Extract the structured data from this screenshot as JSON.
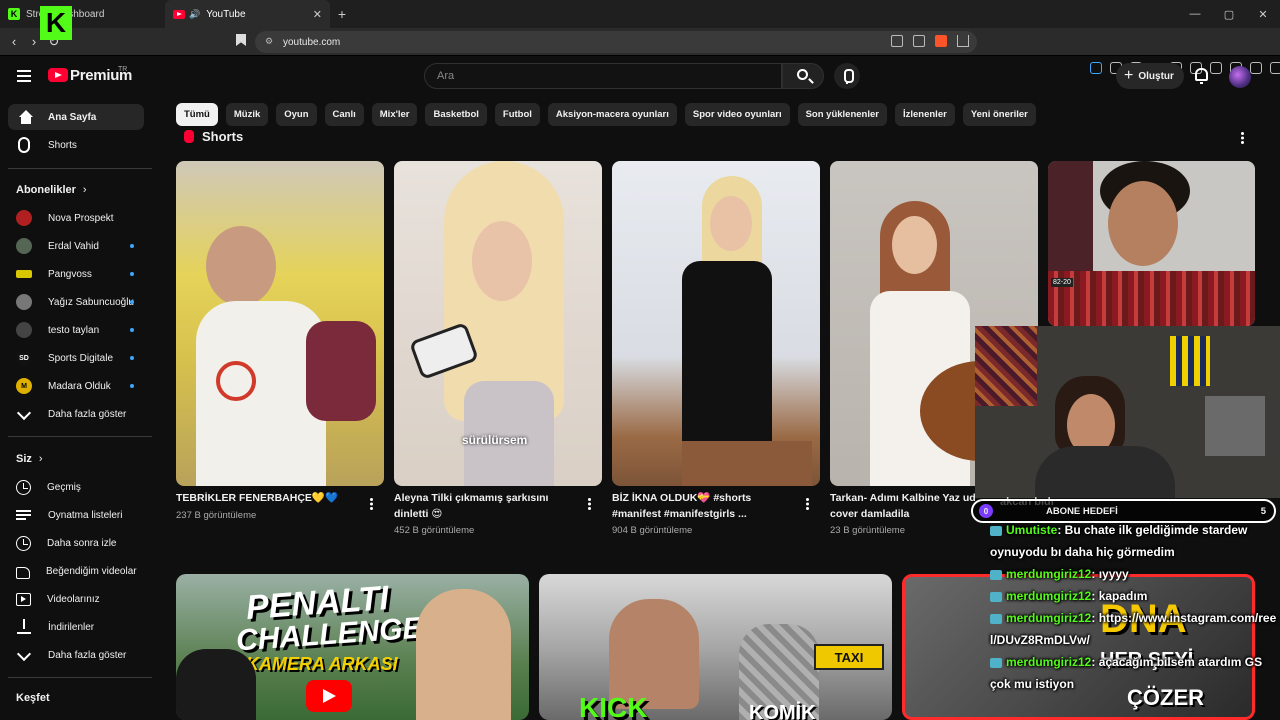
{
  "browser": {
    "tabs": [
      {
        "title": "Stre... Dashboard",
        "favicon": "kick-favicon"
      },
      {
        "title": "YouTube",
        "favicon": "youtube-favicon"
      }
    ],
    "url": "youtube.com",
    "kick_logo": "K"
  },
  "header": {
    "logo_text": "Premium",
    "logo_sup": "TR",
    "search_placeholder": "Ara",
    "create_label": "Oluştur"
  },
  "sidebar": {
    "main": [
      {
        "label": "Ana Sayfa",
        "icon": "home-icon",
        "active": true
      },
      {
        "label": "Shorts",
        "icon": "shorts-icon"
      }
    ],
    "subscriptions_title": "Abonelikler",
    "subscriptions": [
      {
        "label": "Nova Prospekt",
        "dot": false,
        "color": "#b02020"
      },
      {
        "label": "Erdal Vahid",
        "dot": true,
        "color": "#556655"
      },
      {
        "label": "Pangvoss",
        "dot": true,
        "color": "#d8c800"
      },
      {
        "label": "Yağız Sabuncuoğlu",
        "dot": true,
        "color": "#777777"
      },
      {
        "label": "testo taylan",
        "dot": true,
        "color": "#444444"
      },
      {
        "label": "Sports Digitale",
        "dot": true,
        "color": "#111111"
      },
      {
        "label": "Madara Olduk",
        "dot": true,
        "color": "#e0b000"
      }
    ],
    "show_more": "Daha fazla göster",
    "you_title": "Siz",
    "you_items": [
      {
        "label": "Geçmiş",
        "icon": "history-icon"
      },
      {
        "label": "Oynatma listeleri",
        "icon": "playlists-icon"
      },
      {
        "label": "Daha sonra izle",
        "icon": "watch-later-icon"
      },
      {
        "label": "Beğendiğim videolar",
        "icon": "liked-videos-icon"
      },
      {
        "label": "Videolarınız",
        "icon": "your-videos-icon"
      },
      {
        "label": "İndirilenler",
        "icon": "downloads-icon"
      },
      {
        "label": "Daha fazla göster",
        "icon": "chevron-down-icon"
      }
    ],
    "explore_title": "Keşfet"
  },
  "chips": [
    "Tümü",
    "Müzik",
    "Oyun",
    "Canlı",
    "Mix'ler",
    "Basketbol",
    "Futbol",
    "Aksiyon-macera oyunları",
    "Spor video oyunları",
    "Son yüklenenler",
    "İzlenenler",
    "Yeni öneriler"
  ],
  "shorts_title": "Shorts",
  "shorts": [
    {
      "title": "TEBRİKLER FENERBAHÇE💛💙",
      "views": "237 B görüntüleme"
    },
    {
      "title": "Aleyna Tilki çıkmamış şarkısını dinletti 😍",
      "views": "452 B görüntüleme",
      "overlay": "sürülürsem"
    },
    {
      "title": "BİZ İKNA OLDUK💝 #shorts #manifest #manifestgirls ...",
      "views": "904 B görüntüleme"
    },
    {
      "title": "Tarkan- Adımı Kalbine Yaz ud cover damladila",
      "views": "23 B görüntüleme"
    }
  ],
  "videos": [
    {
      "line1": "PENALTI",
      "line2": "CHALLENGE",
      "line3": "KAMERA ARKASI"
    },
    {
      "line1": "KICK",
      "line2": "KOMİK",
      "sign": "TAXI"
    },
    {
      "line1": "DNA",
      "line2": "HER ŞEYİ",
      "line3": "ÇÖZER"
    }
  ],
  "stream": {
    "goal_label": "ABONE HEDEFİ",
    "goal_current": "0",
    "goal_target": "5",
    "partial_under": "akcan bıdı",
    "chat": [
      {
        "user": "Umutiste",
        "msg": ": Bu chate ilk geldiğimde stardew oynuyodu bı daha hiç görmedim"
      },
      {
        "user": "merdumgiriz12",
        "msg": ": ıyyyy"
      },
      {
        "user": "merdumgiriz12",
        "msg": ": kapadım"
      },
      {
        "user": "merdumgiriz12",
        "msg": ": https://www.instagram.com/reel/DUvZ8RmDLVw/"
      },
      {
        "user": "merdumgiriz12",
        "msg": ": açacağım bilsem atardım GS çok mu istiyon"
      }
    ]
  }
}
